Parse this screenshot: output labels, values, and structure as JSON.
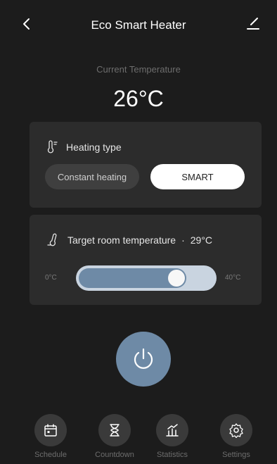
{
  "header": {
    "title": "Eco Smart Heater",
    "back_icon": "chevron-left-icon",
    "edit_icon": "edit-pencil-icon"
  },
  "current": {
    "label": "Current Temperature",
    "value": "26°C"
  },
  "heating_type": {
    "title": "Heating type",
    "icon": "thermometer-icon",
    "options": [
      {
        "label": "Constant heating",
        "selected": false
      },
      {
        "label": "SMART",
        "selected": true
      }
    ]
  },
  "target": {
    "title": "Target room temperature",
    "separator": "·",
    "value": "29°C",
    "icon": "thermometer-icon",
    "min_label": "0°C",
    "max_label": "40°C",
    "min": 0,
    "max": 40,
    "current": 29
  },
  "power": {
    "icon": "power-icon",
    "on": true
  },
  "nav": {
    "items": [
      {
        "label": "Schedule",
        "icon": "calendar-icon"
      },
      {
        "label": "Countdown",
        "icon": "hourglass-icon"
      },
      {
        "label": "Statistics",
        "icon": "chart-icon"
      },
      {
        "label": "Settings",
        "icon": "gear-icon"
      }
    ]
  },
  "colors": {
    "background": "#1c1c1c",
    "card": "#2c2c2c",
    "accent": "#6e8aa6",
    "slider_track": "#c9d4e0"
  }
}
